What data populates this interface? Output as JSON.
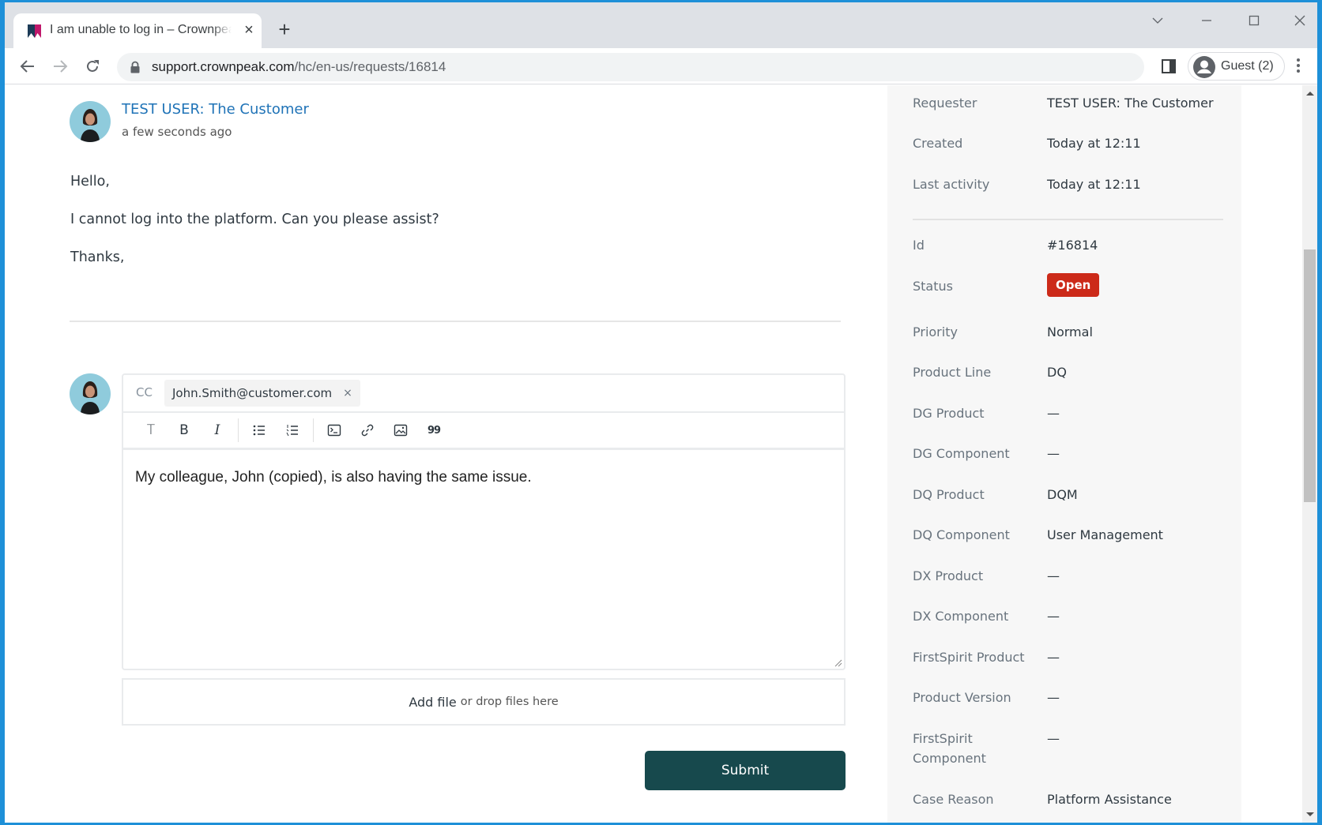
{
  "browser": {
    "tab_title": "I am unable to log in – Crownpeak",
    "tab_close": "×",
    "new_tab": "+",
    "url_host": "support.crownpeak.com",
    "url_path": "/hc/en-us/requests/16814",
    "profile_label": "Guest (2)",
    "colors": {
      "favicon_dark": "#1c3b57",
      "favicon_accent": "#c0186b"
    }
  },
  "comment": {
    "author": "TEST USER: The Customer",
    "timestamp": "a few seconds ago",
    "paragraphs": [
      "Hello,",
      "I cannot log into the platform. Can you please assist?",
      "Thanks,"
    ]
  },
  "reply_form": {
    "cc_label": "CC",
    "cc_recipients": [
      {
        "email": "John.Smith@customer.com",
        "remove": "×"
      }
    ],
    "toolbar": [
      {
        "name": "text-format",
        "glyph": "T"
      },
      {
        "name": "bold",
        "glyph": "B"
      },
      {
        "name": "italic",
        "glyph": "I"
      },
      {
        "name": "bulleted-list",
        "glyph": ""
      },
      {
        "name": "numbered-list",
        "glyph": ""
      },
      {
        "name": "code-block",
        "glyph": ""
      },
      {
        "name": "link",
        "glyph": ""
      },
      {
        "name": "image",
        "glyph": ""
      },
      {
        "name": "blockquote",
        "glyph": "99"
      }
    ],
    "body_text": "My colleague, John (copied), is also having the same issue.",
    "add_file_label": "Add file",
    "drop_hint": "or drop files here",
    "submit_label": "Submit",
    "submit_color": "#17494d"
  },
  "sidebar": {
    "meta": [
      {
        "label": "Requester",
        "value": "TEST USER: The Customer"
      },
      {
        "label": "Created",
        "value": "Today at 12:11"
      },
      {
        "label": "Last activity",
        "value": "Today at 12:11"
      }
    ],
    "fields": [
      {
        "label": "Id",
        "value": "#16814"
      },
      {
        "label": "Status",
        "value": "Open",
        "badge_color": "#cc2a19"
      },
      {
        "label": "Priority",
        "value": "Normal"
      },
      {
        "label": "Product Line",
        "value": "DQ"
      },
      {
        "label": "DG Product",
        "value": "—"
      },
      {
        "label": "DG Component",
        "value": "—"
      },
      {
        "label": "DQ Product",
        "value": "DQM"
      },
      {
        "label": "DQ Component",
        "value": "User Management"
      },
      {
        "label": "DX Product",
        "value": "—"
      },
      {
        "label": "DX Component",
        "value": "—"
      },
      {
        "label": "FirstSpirit Product",
        "value": "—"
      },
      {
        "label": "Product Version",
        "value": "—"
      },
      {
        "label": "FirstSpirit Component",
        "value": "—"
      },
      {
        "label": "Case Reason",
        "value": "Platform Assistance"
      }
    ]
  }
}
